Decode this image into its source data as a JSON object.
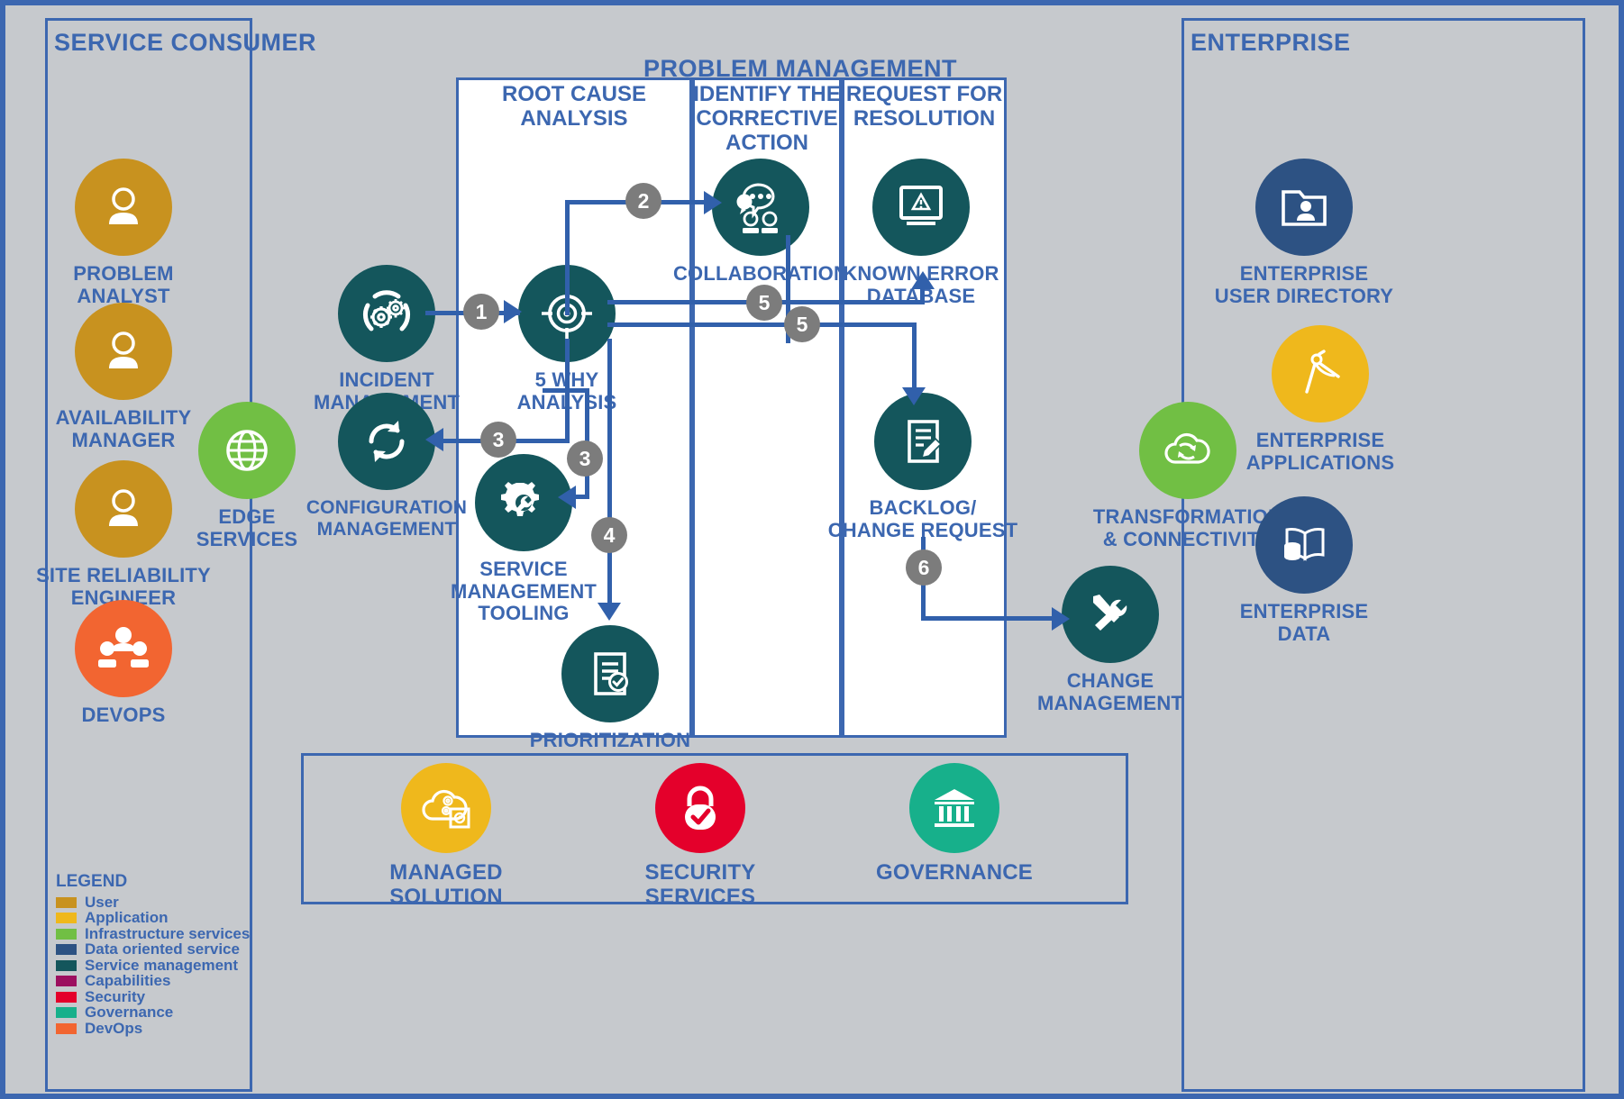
{
  "zones": {
    "service_consumer": {
      "title": "SERVICE CONSUMER"
    },
    "problem_management": {
      "title": "PROBLEM MANAGEMENT"
    },
    "enterprise": {
      "title": "ENTERPRISE"
    }
  },
  "columns": [
    {
      "id": "root-cause-analysis",
      "title": "ROOT CAUSE\nANALYSIS"
    },
    {
      "id": "identify-corrective-action",
      "title": "IDENTIFY THE\nCORRECTIVE\nACTION"
    },
    {
      "id": "request-for-resolution",
      "title": "REQUEST FOR\nRESOLUTION"
    }
  ],
  "consumer_nodes": [
    {
      "id": "problem-analyst",
      "label": "PROBLEM\nANALYST",
      "color": "#c8921f",
      "icon": "user-icon"
    },
    {
      "id": "availability-manager",
      "label": "AVAILABILITY\nMANAGER",
      "color": "#c8921f",
      "icon": "user-icon"
    },
    {
      "id": "site-reliability-engineer",
      "label": "SITE RELIABILITY\nENGINEER",
      "color": "#c8921f",
      "icon": "user-icon"
    },
    {
      "id": "devops",
      "label": "DEVOPS",
      "color": "#f26531",
      "icon": "devops-group-icon"
    },
    {
      "id": "edge-services",
      "label": "EDGE\nSERVICES",
      "color": "#71bf44",
      "icon": "globe-icon"
    }
  ],
  "process_nodes": [
    {
      "id": "incident-management",
      "label": "INCIDENT\nMANAGEMENT",
      "color": "#14565c",
      "icon": "gears-incident-icon"
    },
    {
      "id": "five-why-analysis",
      "label": "5 WHY\nANALYSIS",
      "color": "#14565c",
      "icon": "target-icon"
    },
    {
      "id": "configuration-management",
      "label": "CONFIGURATION\nMANAGEMENT",
      "color": "#14565c",
      "icon": "refresh-arrows-icon"
    },
    {
      "id": "service-management-tooling",
      "label": "SERVICE\nMANAGEMENT\nTOOLING",
      "color": "#14565c",
      "icon": "gear-wrench-icon"
    },
    {
      "id": "prioritization",
      "label": "PRIORITIZATION",
      "color": "#14565c",
      "icon": "checklist-icon"
    },
    {
      "id": "collaboration",
      "label": "COLLABORATION",
      "color": "#14565c",
      "icon": "collaboration-chat-icon"
    },
    {
      "id": "known-error-database",
      "label": "KNOWN ERROR\nDATABASE",
      "color": "#14565c",
      "icon": "monitor-warning-icon"
    },
    {
      "id": "backlog-change-request",
      "label": "BACKLOG/\nCHANGE REQUEST",
      "color": "#14565c",
      "icon": "document-pencil-icon"
    },
    {
      "id": "change-management",
      "label": "CHANGE\nMANAGEMENT",
      "color": "#14565c",
      "icon": "wrench-screwdriver-icon"
    }
  ],
  "enterprise_nodes": [
    {
      "id": "enterprise-user-directory",
      "label": "ENTERPRISE\nUSER DIRECTORY",
      "color": "#2d5283",
      "icon": "folder-user-icon"
    },
    {
      "id": "enterprise-applications",
      "label": "ENTERPRISE\nAPPLICATIONS",
      "color": "#efb81c",
      "icon": "compass-icon"
    },
    {
      "id": "transformation-connectivity",
      "label": "TRANSFORMATION\n& CONNECTIVITY",
      "color": "#71bf44",
      "icon": "cloud-sync-icon"
    },
    {
      "id": "enterprise-data",
      "label": "ENTERPRISE\nDATA",
      "color": "#2d5283",
      "icon": "book-database-icon"
    }
  ],
  "bottom_nodes": [
    {
      "id": "managed-solution",
      "label": "MANAGED\nSOLUTION",
      "color": "#efb81c",
      "icon": "cloud-gears-icon"
    },
    {
      "id": "security-services",
      "label": "SECURITY\nSERVICES",
      "color": "#e4002b",
      "icon": "lock-check-icon"
    },
    {
      "id": "governance",
      "label": "GOVERNANCE",
      "color": "#17b08b",
      "icon": "bank-icon"
    }
  ],
  "steps": [
    {
      "id": "step-1",
      "number": "1"
    },
    {
      "id": "step-2",
      "number": "2"
    },
    {
      "id": "step-3a",
      "number": "3"
    },
    {
      "id": "step-3b",
      "number": "3"
    },
    {
      "id": "step-4",
      "number": "4"
    },
    {
      "id": "step-5a",
      "number": "5"
    },
    {
      "id": "step-5b",
      "number": "5"
    },
    {
      "id": "step-6",
      "number": "6"
    }
  ],
  "legend": {
    "title": "LEGEND",
    "items": [
      {
        "label": "User",
        "color": "#c8921f"
      },
      {
        "label": "Application",
        "color": "#efb81c"
      },
      {
        "label": "Infrastructure services",
        "color": "#71bf44"
      },
      {
        "label": "Data oriented service",
        "color": "#2d5283"
      },
      {
        "label": "Service management",
        "color": "#14565c"
      },
      {
        "label": "Capabilities",
        "color": "#9c0f5f"
      },
      {
        "label": "Security",
        "color": "#e4002b"
      },
      {
        "label": "Governance",
        "color": "#17b08b"
      },
      {
        "label": "DevOps",
        "color": "#f26531"
      }
    ]
  }
}
